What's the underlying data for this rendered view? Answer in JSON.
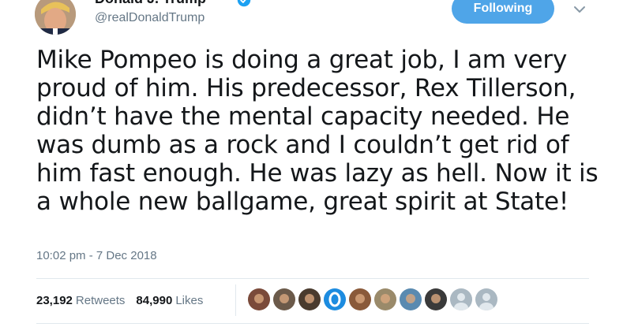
{
  "header": {
    "display_name": "Donald J. Trump",
    "handle": "@realDonaldTrump",
    "follow_label": "Following"
  },
  "tweet": {
    "text": "Mike Pompeo is doing a great job, I am very proud of him. His predecessor, Rex Tillerson, didn’t have the mental capacity needed. He was dumb as a rock and I couldn’t get rid of him fast enough. He was lazy as hell. Now it is a whole new ballgame, great spirit at State!",
    "timestamp": "10:02 pm - 7 Dec 2018"
  },
  "stats": {
    "retweets_count": "23,192",
    "retweets_label": "Retweets",
    "likes_count": "84,990",
    "likes_label": "Likes"
  },
  "liker_avatars": [
    {
      "name": "liker-avatar-1",
      "color": "#7a4a3a"
    },
    {
      "name": "liker-avatar-2",
      "color": "#6b5a4a"
    },
    {
      "name": "liker-avatar-3",
      "color": "#4a3b2e"
    },
    {
      "name": "liker-avatar-4",
      "color": "#1d8ce0"
    },
    {
      "name": "liker-avatar-5",
      "color": "#8a5a3a"
    },
    {
      "name": "liker-avatar-6",
      "color": "#9a8a6a"
    },
    {
      "name": "liker-avatar-7",
      "color": "#5a8ab0"
    },
    {
      "name": "liker-avatar-8",
      "color": "#3a3a3a"
    },
    {
      "name": "liker-avatar-9",
      "color": "#aab8c2"
    },
    {
      "name": "liker-avatar-10",
      "color": "#aab8c2"
    }
  ],
  "colors": {
    "accent": "#4fa5e8",
    "muted": "#657786",
    "text": "#14171a",
    "divider": "#e1e8ed"
  },
  "icons": {
    "verified": "verified-badge-icon",
    "menu": "chevron-down-icon"
  }
}
